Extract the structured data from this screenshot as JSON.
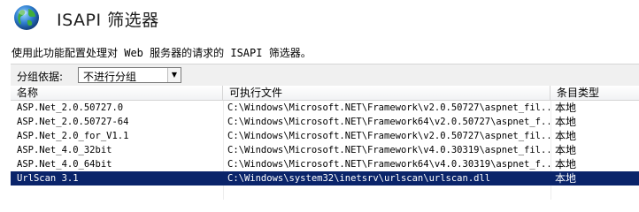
{
  "page": {
    "title": "ISAPI 筛选器",
    "description": "使用此功能配置处理对 Web 服务器的请求的 ISAPI 筛选器。"
  },
  "toolbar": {
    "group_by_label": "分组依据:",
    "group_by_value": "不进行分组"
  },
  "table": {
    "columns": [
      "名称",
      "可执行文件",
      "条目类型"
    ],
    "sorted_column": "名称",
    "rows": [
      {
        "name": "ASP.Net_2.0.50727.0",
        "path": "C:\\Windows\\Microsoft.NET\\Framework\\v2.0.50727\\aspnet_fil...",
        "type": "本地"
      },
      {
        "name": "ASP.Net_2.0.50727-64",
        "path": "C:\\Windows\\Microsoft.NET\\Framework64\\v2.0.50727\\aspnet_f...",
        "type": "本地"
      },
      {
        "name": "ASP.Net_2.0_for_V1.1",
        "path": "C:\\Windows\\Microsoft.NET\\Framework\\v2.0.50727\\aspnet_fil...",
        "type": "本地"
      },
      {
        "name": "ASP.Net_4.0_32bit",
        "path": "C:\\Windows\\Microsoft.NET\\Framework\\v4.0.30319\\aspnet_fil...",
        "type": "本地"
      },
      {
        "name": "ASP.Net_4.0_64bit",
        "path": "C:\\Windows\\Microsoft.NET\\Framework64\\v4.0.30319\\aspnet_f...",
        "type": "本地"
      },
      {
        "name": "UrlScan 3.1",
        "path": "C:\\Windows\\system32\\inetsrv\\urlscan\\urlscan.dll",
        "type": "本地"
      }
    ],
    "selected_row": 5
  },
  "colors": {
    "selection": "#0a246a",
    "header_text": "#1d1d1d"
  }
}
